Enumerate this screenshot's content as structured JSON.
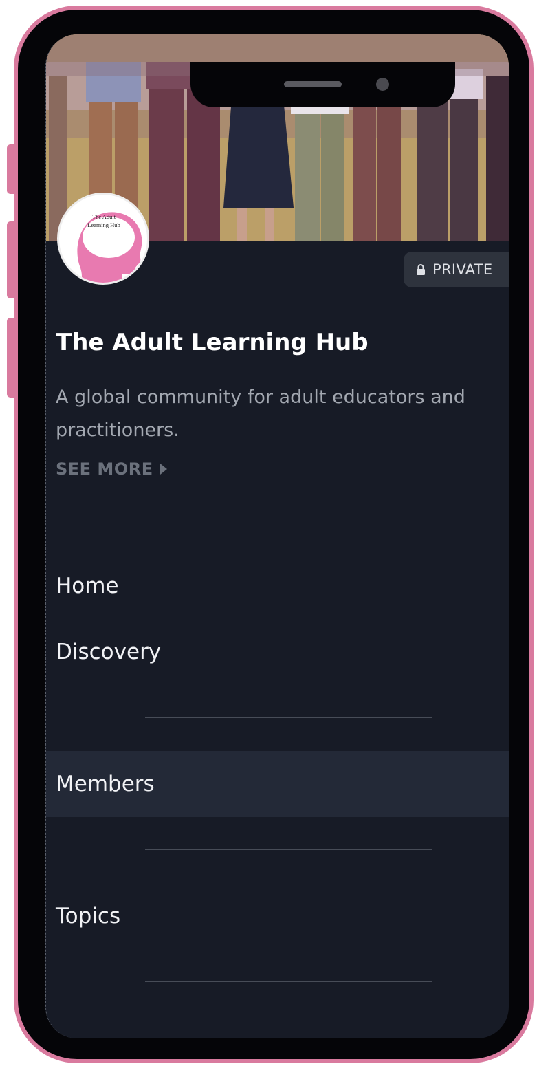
{
  "group": {
    "logo_text": "The Adult\nLearning Hub",
    "privacy_label": "PRIVATE",
    "title": "The Adult Learning Hub",
    "description": "A global community for adult educators and practitioners.",
    "see_more_label": "SEE MORE"
  },
  "nav": {
    "items": [
      {
        "label": "Home",
        "active": false
      },
      {
        "label": "Discovery",
        "active": false
      },
      {
        "label": "Members",
        "active": true
      },
      {
        "label": "Topics",
        "active": false
      }
    ]
  },
  "colors": {
    "phone_frame": "#d97a9e",
    "screen_background": "#171b26",
    "active_nav_background": "#232937",
    "logo_pink": "#e87ab0"
  },
  "icons": [
    "lock-icon",
    "chevron-right-icon"
  ]
}
